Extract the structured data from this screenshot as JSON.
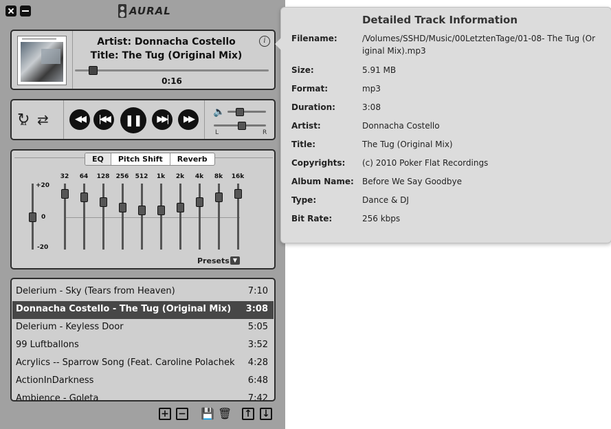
{
  "app": {
    "name": "AURAL"
  },
  "window": {
    "close_icon": "close-icon",
    "minimize_icon": "minimize-icon"
  },
  "now_playing": {
    "artist_line": "Artist: Donnacha Costello",
    "title_line": "Title: The Tug (Original Mix)",
    "time": "0:16",
    "seek_fraction": 0.09,
    "info_icon": "i"
  },
  "player": {
    "repeat_badge": "A1",
    "volume_fraction": 0.15,
    "balance_left": "L",
    "balance_right": "R",
    "balance_fraction": 0.5
  },
  "effects": {
    "tabs": [
      "EQ",
      "Pitch Shift",
      "Reverb"
    ],
    "active_tab": "EQ",
    "scale": {
      "max": "+20",
      "zero": "0",
      "min": "-20"
    },
    "preamp_db": 0,
    "bands": [
      {
        "freq": "32",
        "db": 14
      },
      {
        "freq": "64",
        "db": 12
      },
      {
        "freq": "128",
        "db": 9
      },
      {
        "freq": "256",
        "db": 6
      },
      {
        "freq": "512",
        "db": 4
      },
      {
        "freq": "1k",
        "db": 4
      },
      {
        "freq": "2k",
        "db": 6
      },
      {
        "freq": "4k",
        "db": 9
      },
      {
        "freq": "8k",
        "db": 12
      },
      {
        "freq": "16k",
        "db": 14
      }
    ],
    "presets_label": "Presets"
  },
  "playlist": {
    "tracks": [
      {
        "title": "Delerium - Sky (Tears from Heaven)",
        "duration": "7:10"
      },
      {
        "title": "Donnacha Costello - The Tug (Original Mix)",
        "duration": "3:08"
      },
      {
        "title": "Delerium - Keyless Door",
        "duration": "5:05"
      },
      {
        "title": "99 Luftballons",
        "duration": "3:52"
      },
      {
        "title": "Acrylics -- Sparrow Song (Feat. Caroline Polachek",
        "duration": "4:28"
      },
      {
        "title": "ActionInDarkness",
        "duration": "6:48"
      },
      {
        "title": "Ambience - Goleta",
        "duration": "7:42"
      }
    ],
    "selected_index": 1
  },
  "track_info": {
    "heading": "Detailed Track Information",
    "fields": [
      {
        "label": "Filename:",
        "value": "/Volumes/SSHD/Music/00LetztenTage/01-08- The Tug (Original Mix).mp3"
      },
      {
        "label": "Size:",
        "value": "5.91 MB"
      },
      {
        "label": "Format:",
        "value": "mp3"
      },
      {
        "label": "Duration:",
        "value": "3:08"
      },
      {
        "label": "Artist:",
        "value": "Donnacha Costello"
      },
      {
        "label": "Title:",
        "value": "The Tug (Original Mix)"
      },
      {
        "label": "Copyrights:",
        "value": "(c) 2010 Poker Flat Recordings"
      },
      {
        "label": "Album Name:",
        "value": "Before We Say Goodbye"
      },
      {
        "label": "Type:",
        "value": "Dance & DJ"
      },
      {
        "label": "Bit Rate:",
        "value": "256 kbps"
      }
    ]
  }
}
